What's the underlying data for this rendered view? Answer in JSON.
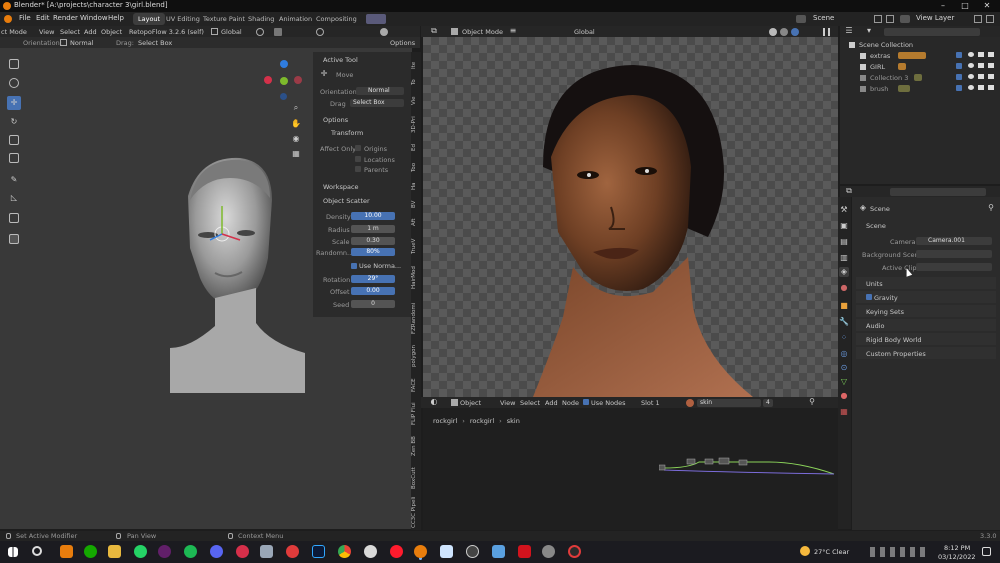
{
  "titlebar": {
    "title": "Blender* [A:\\projects\\character 3\\girl.blend]"
  },
  "menubar": {
    "menus": [
      "File",
      "Edit",
      "Render",
      "Window",
      "Help"
    ],
    "workspaces": [
      "Layout",
      "UV Editing",
      "Texture Paint",
      "Shading",
      "Animation",
      "Compositing"
    ],
    "active_workspace": "Layout",
    "scene_name": "Scene",
    "view_layer": "View Layer"
  },
  "viewport_header": {
    "mode": "ct Mode",
    "menus": [
      "View",
      "Select",
      "Add",
      "Object"
    ],
    "addon": "RetopoFlow 3.2.6 (self)",
    "transform_orientation": "Global",
    "orientation_label": "Orientation:",
    "orientation_value": "Normal",
    "drag_label": "Drag:",
    "drag_value": "Select Box",
    "options": "Options"
  },
  "active_tool_panel": {
    "title": "Active Tool",
    "tool_name": "Move",
    "orientation_label": "Orientation",
    "orientation_value": "Normal",
    "drag_label": "Drag",
    "drag_value": "Select Box",
    "options_title": "Options",
    "transform_title": "Transform",
    "affect_only_label": "Affect Only",
    "affect_options": [
      "Origins",
      "Locations",
      "Parents"
    ],
    "workspace_title": "Workspace",
    "object_scatter_title": "Object Scatter",
    "scatter_fields": [
      {
        "label": "Density",
        "value": "10.00",
        "style": "blue"
      },
      {
        "label": "Radius",
        "value": "1 m",
        "style": "dark"
      },
      {
        "label": "Scale",
        "value": "0.30",
        "style": "dark"
      },
      {
        "label": "Randomn...",
        "value": "80%",
        "style": "blue"
      }
    ],
    "use_normal_label": "Use Norma...",
    "scatter_fields_2": [
      {
        "label": "Rotation",
        "value": "29°",
        "style": "blue"
      },
      {
        "label": "Offset",
        "value": "0.00",
        "style": "blue"
      },
      {
        "label": "Seed",
        "value": "0",
        "style": "dark"
      }
    ]
  },
  "sidebar_tabs": [
    "Ite",
    "To",
    "Vie",
    "3D-Pri",
    "Ed",
    "Too",
    "Ha",
    "BV",
    "Aft",
    "TrueV",
    "HairMod",
    "FZRandomi",
    "polygon",
    "FACE",
    "FLIP Flui",
    "Zen BB",
    "BoxCutt",
    "CC3C Pipeli"
  ],
  "render_header": {
    "mode": "Object Mode",
    "transform_orientation": "Global"
  },
  "outliner": {
    "root": "Scene Collection",
    "items": [
      "extras",
      "GIRL",
      "Collection 3",
      "brush"
    ]
  },
  "properties": {
    "breadcrumb": "Scene",
    "section": "Scene",
    "camera_label": "Camera",
    "camera_value": "Camera.001",
    "background_label": "Background Scene",
    "active_clip_label": "Active Clip",
    "subsections": [
      "Units",
      "Gravity",
      "Keying Sets",
      "Audio",
      "Rigid Body World",
      "Custom Properties"
    ],
    "gravity_checked": true
  },
  "node_editor": {
    "mode": "Object",
    "menus": [
      "View",
      "Select",
      "Add",
      "Node"
    ],
    "use_nodes_label": "Use Nodes",
    "slot": "Slot 1",
    "material": "skin",
    "user_count": "4",
    "breadcrumb": [
      "rockgirl",
      "rockgirl",
      "skin"
    ]
  },
  "statusbar": {
    "left": "Set Active Modifier",
    "middle": "Pan View",
    "right": "Context Menu",
    "version": "3.3.0"
  },
  "taskbar": {
    "weather": "27°C  Clear",
    "time": "8:12 PM",
    "date": "03/12/2022"
  },
  "colors": {
    "accent_blue": "#4772b3",
    "panel_bg": "#2a2a2a",
    "viewport_bg": "#393939"
  }
}
